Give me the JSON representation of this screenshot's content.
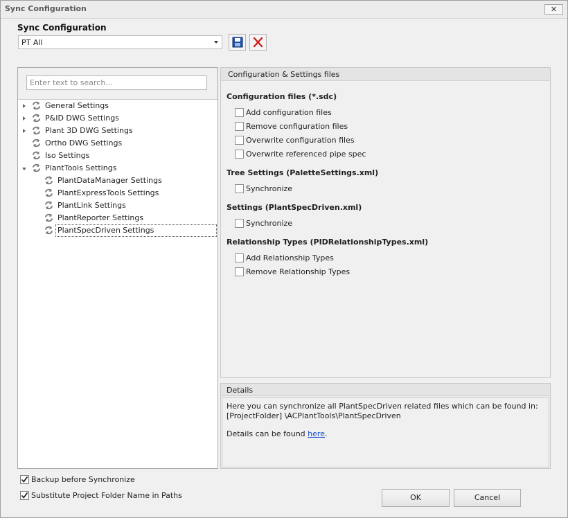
{
  "window": {
    "title": "Sync Configuration",
    "close_label": "✕"
  },
  "section_title": "Sync Configuration",
  "config_select": {
    "value": "PT All"
  },
  "search": {
    "placeholder": "Enter text to search..."
  },
  "tree": [
    {
      "label": "General Settings"
    },
    {
      "label": "P&ID DWG Settings"
    },
    {
      "label": "Plant 3D DWG Settings"
    },
    {
      "label": "Ortho DWG Settings"
    },
    {
      "label": "Iso Settings"
    },
    {
      "label": "PlantTools Settings"
    },
    {
      "label": "PlantDataManager Settings"
    },
    {
      "label": "PlantExpressTools Settings"
    },
    {
      "label": "PlantLink Settings"
    },
    {
      "label": "PlantReporter Settings"
    },
    {
      "label": "PlantSpecDriven Settings"
    }
  ],
  "config_panel": {
    "header": "Configuration & Settings files",
    "groups": [
      {
        "title": "Configuration files (*.sdc)",
        "options": [
          "Add configuration files",
          "Remove configuration files",
          "Overwrite configuration files",
          "Overwrite referenced pipe spec"
        ]
      },
      {
        "title": "Tree Settings (PaletteSettings.xml)",
        "options": [
          "Synchronize"
        ]
      },
      {
        "title": "Settings (PlantSpecDriven.xml)",
        "options": [
          "Synchronize"
        ]
      },
      {
        "title": "Relationship Types (PIDRelationshipTypes.xml)",
        "options": [
          "Add Relationship Types",
          "Remove Relationship Types"
        ]
      }
    ]
  },
  "details": {
    "header": "Details",
    "line1": "Here you can synchronize all PlantSpecDriven related files which can be found in:",
    "line2": "[ProjectFolder] \\ACPlantTools\\PlantSpecDriven",
    "line3_prefix": "Details can be found ",
    "line3_link": "here",
    "line3_suffix": "."
  },
  "options": {
    "backup": {
      "label": "Backup before Synchronize",
      "checked": true
    },
    "substitute": {
      "label": "Substitute Project Folder Name in Paths",
      "checked": true
    }
  },
  "buttons": {
    "ok": "OK",
    "cancel": "Cancel"
  },
  "colors": {
    "save_icon": "#1f4fa8",
    "delete_icon": "#d21a1a",
    "link": "#1a4fd0"
  }
}
